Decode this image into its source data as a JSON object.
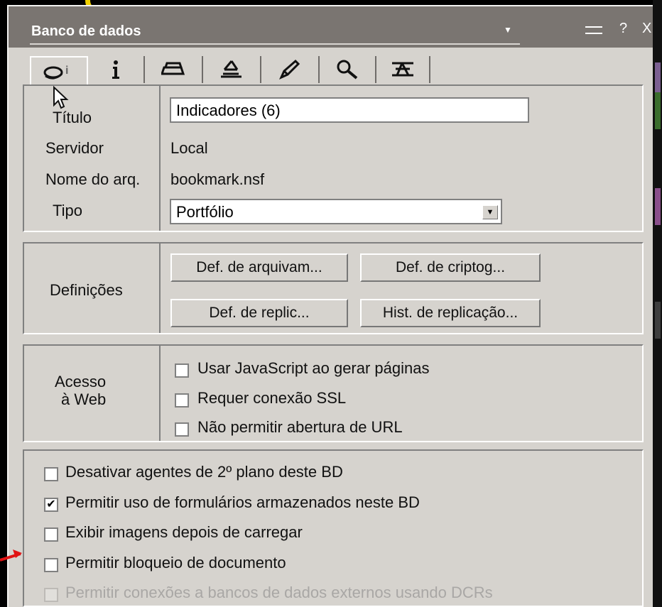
{
  "window": {
    "title": "Banco de dados",
    "title_dropdown_icon": "triangle-down",
    "controls": {
      "minimize_icon": "minimize-bar",
      "help": "?",
      "close": "X"
    }
  },
  "tabs": [
    {
      "name": "basics",
      "icon": "database-info-icon",
      "active": true
    },
    {
      "name": "info",
      "icon": "info-icon"
    },
    {
      "name": "print",
      "icon": "printer-icon"
    },
    {
      "name": "design",
      "icon": "design-icon"
    },
    {
      "name": "launch",
      "icon": "rocket-icon"
    },
    {
      "name": "search",
      "icon": "magnifier-icon"
    },
    {
      "name": "advanced",
      "icon": "advanced-icon"
    }
  ],
  "general": {
    "title_label": "Título",
    "title_value": "Indicadores (6)",
    "server_label": "Servidor",
    "server_value": "Local",
    "filename_label": "Nome do arq.",
    "filename_value": "bookmark.nsf",
    "type_label": "Tipo",
    "type_value": "Portfólio"
  },
  "settings": {
    "label": "Definições",
    "buttons": [
      "Def. de arquivam...",
      "Def. de criptog...",
      "Def. de replic...",
      "Hist. de replicação..."
    ]
  },
  "web_access": {
    "label_line1": "Acesso",
    "label_line2": "à Web",
    "options": [
      {
        "label": "Usar JavaScript ao gerar páginas",
        "checked": false
      },
      {
        "label": "Requer conexão SSL",
        "checked": false
      },
      {
        "label": "Não permitir abertura de URL",
        "checked": false
      }
    ]
  },
  "options": [
    {
      "label": "Desativar agentes de 2º plano deste BD",
      "checked": false
    },
    {
      "label": "Permitir uso de formulários armazenados neste BD",
      "checked": true
    },
    {
      "label": "Exibir imagens depois de carregar",
      "checked": false
    },
    {
      "label": "Permitir bloqueio de documento",
      "checked": false
    },
    {
      "label": "Permitir conexões a bancos de dados externos usando DCRs",
      "checked": false,
      "disabled": true
    }
  ],
  "check_mark": "✔",
  "colors": {
    "dialog_bg": "#d6d3ce",
    "title_bg": "#7a7571",
    "annotation_red": "#e11313",
    "annotation_yellow": "#f2d200"
  }
}
